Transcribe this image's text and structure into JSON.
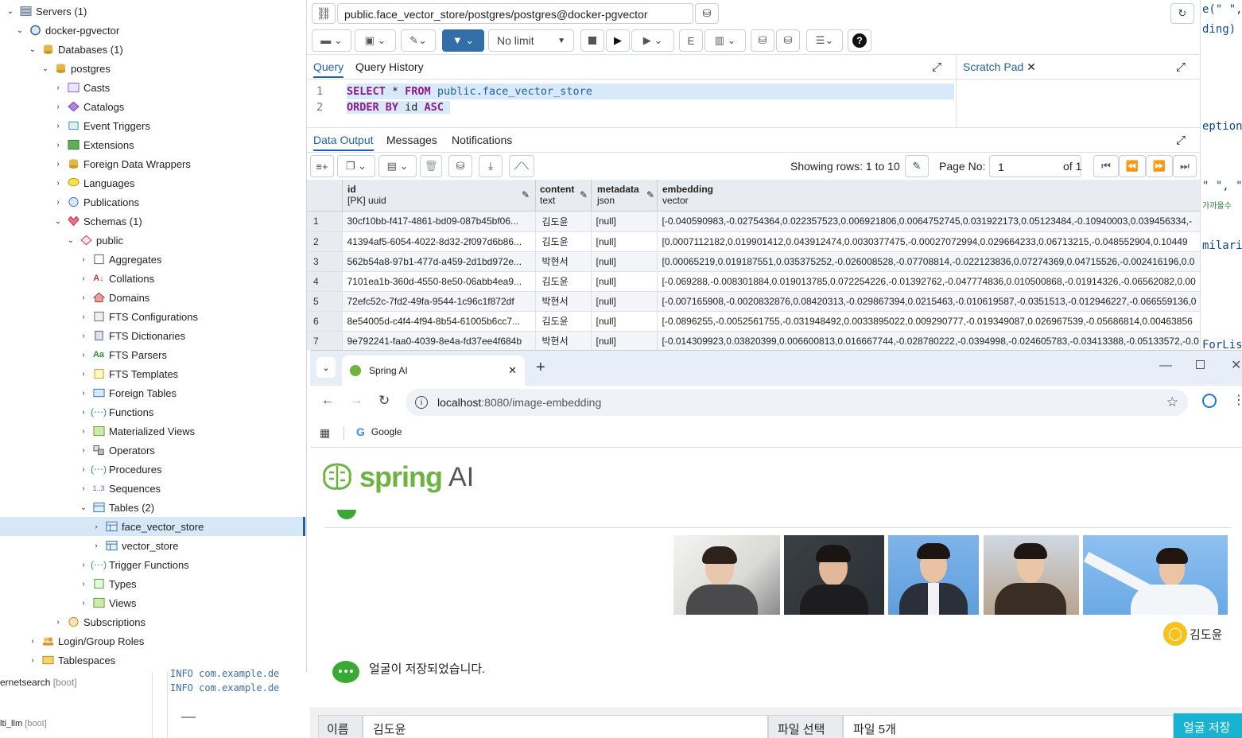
{
  "tree": {
    "servers": "Servers (1)",
    "server": "docker-pgvector",
    "databases": "Databases (1)",
    "db": "postgres",
    "db_items": [
      "Casts",
      "Catalogs",
      "Event Triggers",
      "Extensions",
      "Foreign Data Wrappers",
      "Languages",
      "Publications"
    ],
    "schemas": "Schemas (1)",
    "schema": "public",
    "schema_items": [
      "Aggregates",
      "Collations",
      "Domains",
      "FTS Configurations",
      "FTS Dictionaries",
      "FTS Parsers",
      "FTS Templates",
      "Foreign Tables",
      "Functions",
      "Materialized Views",
      "Operators",
      "Procedures",
      "Sequences"
    ],
    "tables": "Tables (2)",
    "table1": "face_vector_store",
    "table2": "vector_store",
    "after_tables": [
      "Trigger Functions",
      "Types",
      "Views"
    ],
    "subscriptions": "Subscriptions",
    "login_roles": "Login/Group Roles",
    "tablespaces": "Tablespaces"
  },
  "backlog": {
    "left1": "ernetsearch",
    "left1_tag": "[boot]",
    "left2": "lti_llm",
    "left2_tag": "[boot]",
    "line1_level": "INFO",
    "line1_text": "com.example.de",
    "line2_level": "INFO",
    "line2_text": "com.example.de"
  },
  "rightcode": [
    "e(\" \",",
    "ding)",
    "",
    "",
    "",
    "eption",
    "",
    "",
    "\" \", \"",
    "가까울수",
    "",
    "milari",
    "",
    "",
    "",
    "",
    "ForLis"
  ],
  "pg": {
    "connection": "public.face_vector_store/postgres/postgres@docker-pgvector",
    "limit": "No limit",
    "tabs": {
      "query": "Query",
      "history": "Query History",
      "scratch": "Scratch Pad"
    },
    "sql": {
      "l1_kw1": "SELECT",
      "l1_star": " * ",
      "l1_kw2": "FROM",
      "l1_id": " public.face_vector_store",
      "l2_kw1": "ORDER BY",
      "l2_id": " id ",
      "l2_kw2": "ASC"
    },
    "line_numbers": [
      "1",
      "2"
    ],
    "output_tabs": {
      "data": "Data Output",
      "messages": "Messages",
      "notifications": "Notifications"
    },
    "showing": "Showing rows: 1 to 10",
    "page_label": "Page No:",
    "page_value": "1",
    "page_of": "of 1",
    "columns": [
      {
        "name": "id",
        "type": "[PK] uuid"
      },
      {
        "name": "content",
        "type": "text"
      },
      {
        "name": "metadata",
        "type": "json"
      },
      {
        "name": "embedding",
        "type": "vector"
      }
    ],
    "rows": [
      [
        "1",
        "30cf10bb-f417-4861-bd09-087b45bf06...",
        "김도윤",
        "[null]",
        "[-0.040590983,-0.02754364,0.022357523,0.006921806,0.0064752745,0.031922173,0.05123484,-0.10940003,0.039456334,-"
      ],
      [
        "2",
        "41394af5-6054-4022-8d32-2f097d6b86...",
        "김도윤",
        "[null]",
        "[0.0007112182,0.019901412,0.043912474,0.0030377475,-0.00027072994,0.029664233,0.06713215,-0.048552904,0.10449"
      ],
      [
        "3",
        "562b54a8-97b1-477d-a459-2d1bd972e...",
        "박현서",
        "[null]",
        "[0.00065219,0.019187551,0.035375252,-0.026008528,-0.07708814,-0.022123836,0.07274369,0.04715526,-0.002416196,0.0"
      ],
      [
        "4",
        "7101ea1b-360d-4550-8e50-06abb4ea9...",
        "김도윤",
        "[null]",
        "[-0.069288,-0.008301884,0.019013785,0.072254226,-0.01392762,-0.047774836,0.010500868,-0.01914326,-0.06562082,0.00"
      ],
      [
        "5",
        "72efc52c-7fd2-49fa-9544-1c96c1f872df",
        "박현서",
        "[null]",
        "[-0.007165908,-0.0020832876,0.08420313,-0.029867394,0.0215463,-0.010619587,-0.0351513,-0.012946227,-0.066559136,0"
      ],
      [
        "6",
        "8e54005d-c4f4-4f94-8b54-61005b6cc7...",
        "김도윤",
        "[null]",
        "[-0.0896255,-0.0052561755,-0.031948492,0.0033895022,0.009290777,-0.019349087,0.026967539,-0.05686814,0.00463856"
      ],
      [
        "7",
        "9e792241-faa0-4039-8e4a-fd37ee4f684b",
        "박현서",
        "[null]",
        "[-0.014309923,0.03820399,0.006600813,0.016667744,-0.028780222,-0.0394998,-0.024605783,-0.03413388,-0.05133572,-0.0"
      ]
    ]
  },
  "browser": {
    "tab_title": "Spring AI",
    "url_host": "localhost",
    "url_path": ":8080/image-embedding",
    "bookmark_google": "Google",
    "brand_spring": "spring",
    "brand_ai": "AI",
    "user_name": "김도윤",
    "bot_message": "얼굴이 저장되었습니다.",
    "form": {
      "name_label": "이름",
      "name_value": "김도윤",
      "file_button": "파일 선택",
      "file_count": "파일 5개",
      "save_button": "얼굴 저장"
    },
    "colors": {
      "spring_green": "#6db33f",
      "accent_cyan": "#17b3d1",
      "avatar_yellow": "#f7c21b"
    }
  }
}
